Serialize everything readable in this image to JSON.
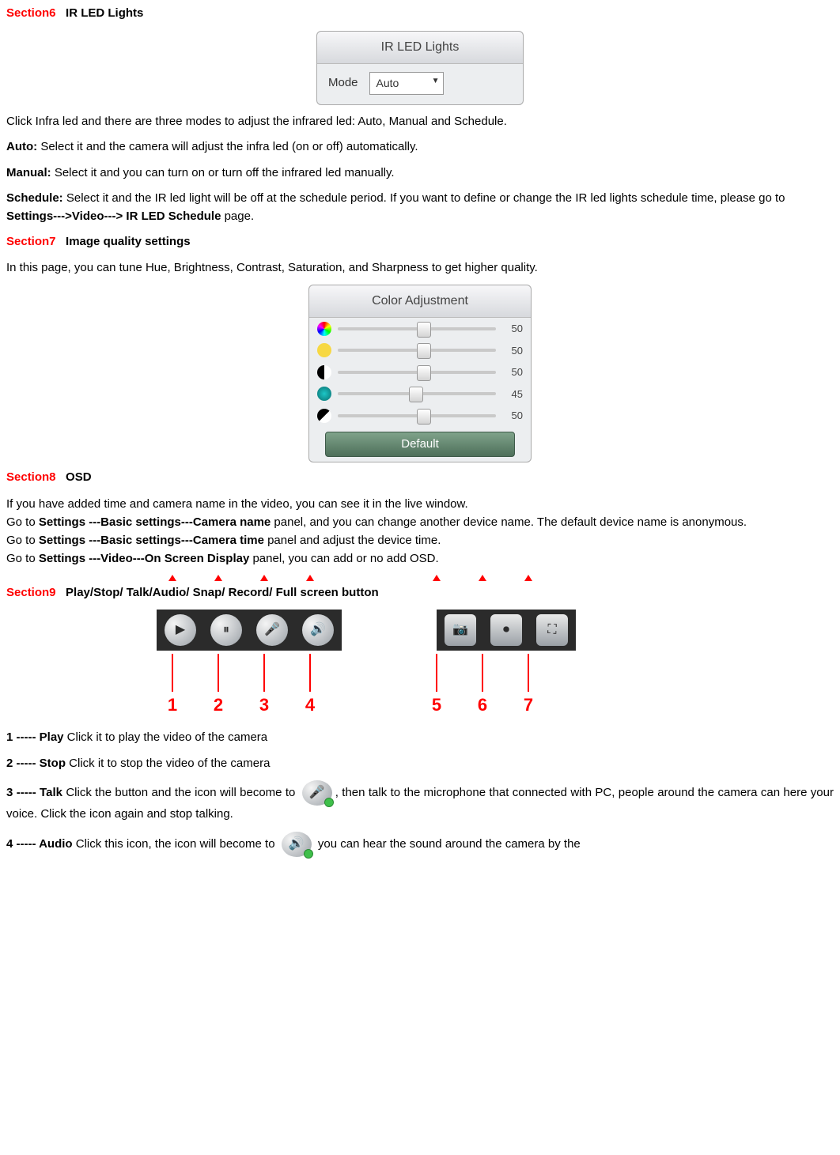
{
  "s6": {
    "label": "Section6",
    "title": "IR LED Lights",
    "panel_title": "IR LED Lights",
    "mode_label": "Mode",
    "mode_value": "Auto",
    "line1": "Click Infra led and there are three modes to adjust the infrared led: Auto, Manual and Schedule.",
    "auto_b": "Auto:",
    "auto_t": " Select it and the camera will adjust the infra led (on or off) automatically.",
    "manual_b": "Manual:",
    "manual_t": " Select it and you can turn on or turn off the infrared led manually.",
    "sched_b": "Schedule:",
    "sched_t1": " Select it and the IR led light will be off at the schedule period. If you want to define or change the IR led lights schedule time, please go to ",
    "sched_path": "Settings--->Video---> IR LED Schedule",
    "sched_t2": " page."
  },
  "s7": {
    "label": "Section7",
    "title": "Image quality settings",
    "intro": "In this page, you can tune Hue, Brightness, Contrast, Saturation, and Sharpness to get higher quality.",
    "panel_title": "Color Adjustment",
    "sliders": [
      {
        "name": "hue",
        "color": "conic-gradient(red,yellow,lime,cyan,blue,magenta,red)",
        "value": "50",
        "pos": "50%"
      },
      {
        "name": "brightness",
        "color": "#f7d843",
        "value": "50",
        "pos": "50%"
      },
      {
        "name": "contrast",
        "color": "linear-gradient(90deg,#000 50%,#fff 50%)",
        "value": "50",
        "pos": "50%"
      },
      {
        "name": "saturation",
        "color": "radial-gradient(#1cc7c7,#0a6e6e)",
        "value": "45",
        "pos": "45%"
      },
      {
        "name": "sharpness",
        "color": "linear-gradient(135deg,#000 50%,#fff 50%)",
        "value": "50",
        "pos": "50%"
      }
    ],
    "default_btn": "Default"
  },
  "s8": {
    "label": "Section8",
    "title": "OSD",
    "l1": "If you have added time and camera name in the video, you can see it in the live window.",
    "l2a": "Go to ",
    "l2b": "Settings ---Basic settings---Camera name",
    "l2c": " panel, and you can change another device name. The default device name is anonymous.",
    "l3a": "Go to ",
    "l3b": "Settings ---Basic settings---Camera time",
    "l3c": " panel and adjust the device time.",
    "l4a": "Go to ",
    "l4b": "Settings ---Video---On Screen Display",
    "l4c": " panel, you can add or no add OSD."
  },
  "s9": {
    "label": "Section9",
    "title": "Play/Stop/ Talk/Audio/ Snap/ Record/ Full screen button",
    "nums1": [
      "1",
      "2",
      "3",
      "4"
    ],
    "nums2": [
      "5",
      "6",
      "7"
    ],
    "item1b": "1 ----- Play",
    "item1t": "   Click it to play the video of the camera",
    "item2b": "2 ----- Stop",
    "item2t": "   Click it to stop the video of the camera",
    "item3b": "3 ----- Talk",
    "item3t1": "   Click the button and the icon will become to ",
    "item3t2": ", then talk to the microphone that connected with PC, people around the camera can here your voice. Click the icon again and stop talking.",
    "item4b": "4 ----- Audio",
    "item4t1": " Click this icon, the icon will become to ",
    "item4t2": " you can hear the sound around the camera by the"
  }
}
